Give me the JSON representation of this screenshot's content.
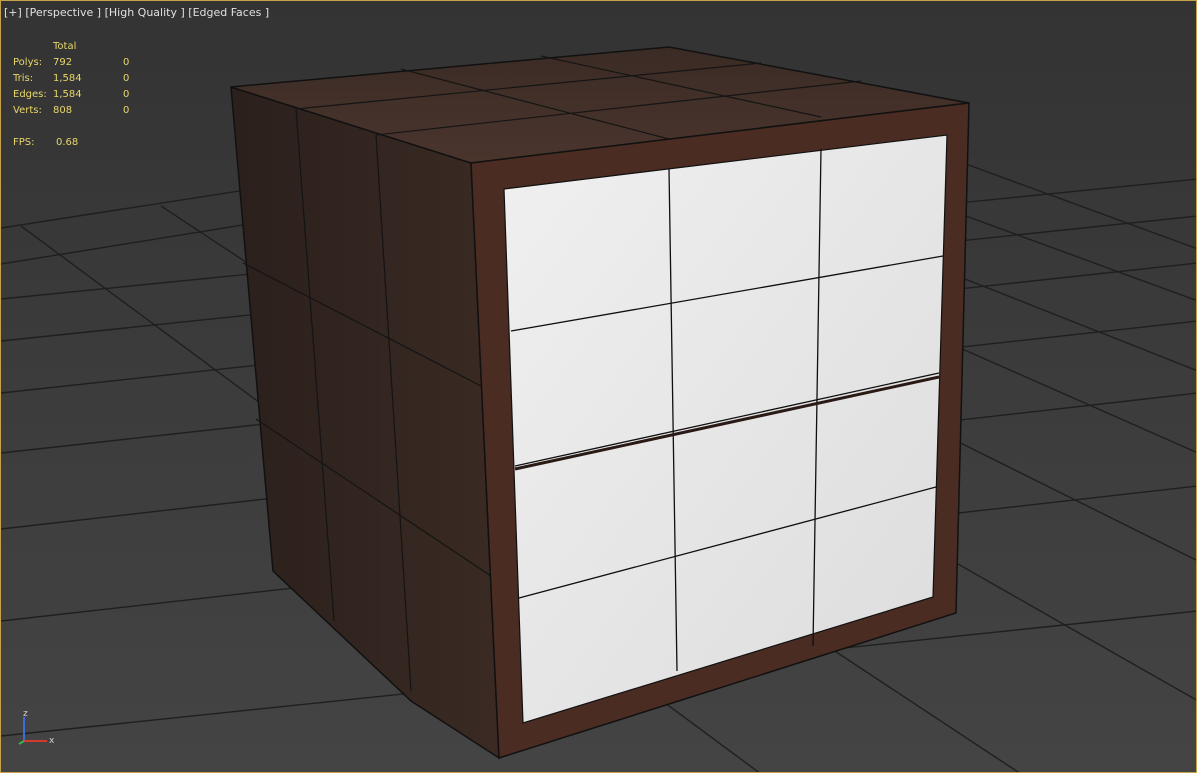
{
  "viewport": {
    "labels": [
      "[+]",
      "[Perspective ]",
      "[High Quality ]",
      "[Edged Faces ]"
    ]
  },
  "stats": {
    "header": "Total",
    "rows": [
      {
        "key": "Polys:",
        "total": "792",
        "sel": "0"
      },
      {
        "key": "Tris:",
        "total": "1,584",
        "sel": "0"
      },
      {
        "key": "Edges:",
        "total": "1,584",
        "sel": "0"
      },
      {
        "key": "Verts:",
        "total": "808",
        "sel": "0"
      }
    ],
    "fps_label": "FPS:",
    "fps_value": "0.68"
  },
  "axis": {
    "z": "z",
    "x": "x"
  },
  "colors": {
    "stats_text": "#e8d66a",
    "label_text": "#e0e0e0",
    "viewport_border": "#c8a24a",
    "wood_dark": "#3b2a23",
    "front_white": "#e9e9e9",
    "frame_brown": "#4a2c22"
  }
}
